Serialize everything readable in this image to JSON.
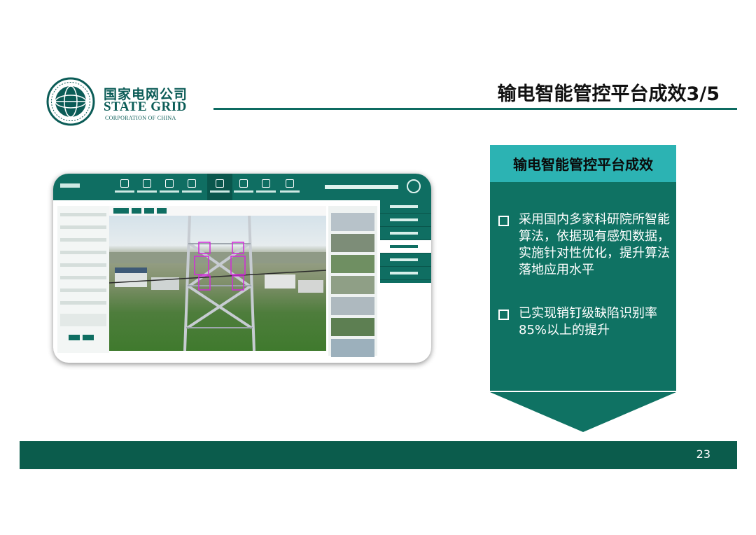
{
  "logo": {
    "company_cn": "国家电网公司",
    "company_en": "STATE GRID",
    "company_sub": "CORPORATION OF CHINA"
  },
  "slide": {
    "title": "输电智能管控平台成效3/5",
    "page_number": "23"
  },
  "panel": {
    "header": "输电智能管控平台成效",
    "bullets": [
      "采用国内多家科研院所智能算法，依据现有感知数据，实施针对性优化，提升算法落地应用水平",
      "已实现销钉级缺陷识别率85%以上的提升"
    ]
  },
  "colors": {
    "brand_dark_green": "#0b5c4c",
    "panel_green": "#0f7263",
    "panel_header_teal": "#2cb3b3",
    "accent_rule": "#0d6b61"
  },
  "icons": {
    "bullet": "hollow-square-icon",
    "logo": "state-grid-globe-emblem"
  }
}
